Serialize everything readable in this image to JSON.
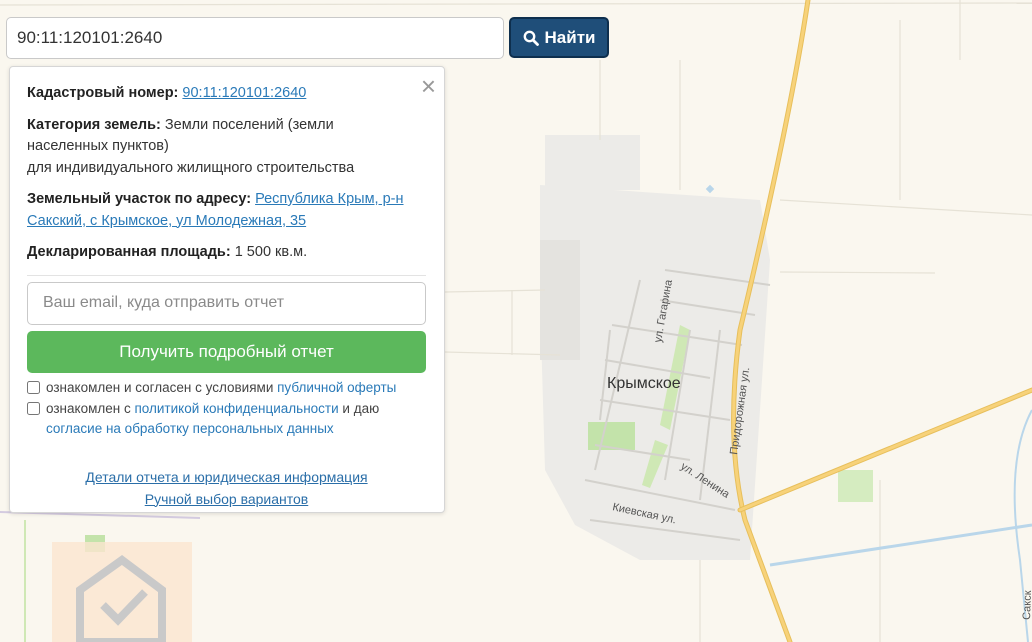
{
  "search": {
    "value": "90:11:120101:2640",
    "button_label": "Найти"
  },
  "panel": {
    "cadastral_label": "Кадастровый номер:",
    "cadastral_value": "90:11:120101:2640",
    "category_label": "Категория земель:",
    "category_line1": "Земли поселений (земли",
    "category_line2": "населенных пунктов)",
    "category_line3": "для индивидуального жилищного строительства",
    "address_label": "Земельный участок по адресу:",
    "address_line1": "Республика Крым, р-н",
    "address_line2": "Сакский, с Крымское, ул Молодежная, 35",
    "area_label": "Декларированная площадь:",
    "area_value": "1 500 кв.м.",
    "email_placeholder": "Ваш email, куда отправить отчет",
    "report_button": "Получить подробный отчет",
    "consent1_text": "ознакомлен и согласен с условиями",
    "consent1_link": "публичной оферты",
    "consent2_text_a": "ознакомлен с",
    "consent2_link_a": "политикой конфиденциальности",
    "consent2_text_b": "и даю",
    "consent2_link_b": "согласие на обработку персональных данных",
    "link_details": "Детали отчета и юридическая информация",
    "link_manual": "Ручной выбор вариантов"
  },
  "map": {
    "town_label": "Крымское",
    "streets": [
      "ул. Гагарина",
      "Придорожная ул.",
      "ул. Ленина",
      "Киевская ул.",
      "Сакск"
    ]
  },
  "colors": {
    "search_button": "#1f4e79",
    "report_button": "#5cb85c",
    "link": "#2a7ab8",
    "map_road": "#f2c766"
  }
}
